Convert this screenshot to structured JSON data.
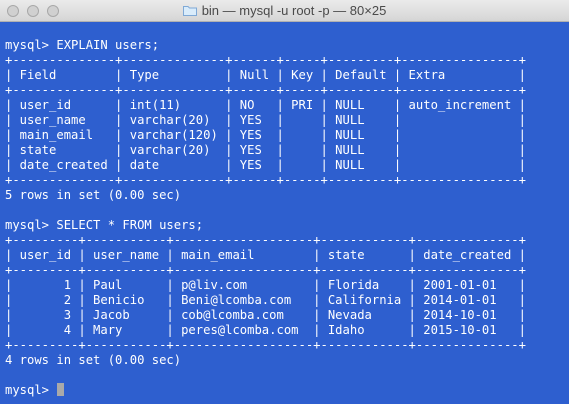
{
  "window": {
    "title": "bin — mysql -u root -p — 80×25"
  },
  "terminal": {
    "lines": [
      "mysql> EXPLAIN users;",
      "+--------------+--------------+------+-----+---------+----------------+",
      "| Field        | Type         | Null | Key | Default | Extra          |",
      "+--------------+--------------+------+-----+---------+----------------+",
      "| user_id      | int(11)      | NO   | PRI | NULL    | auto_increment |",
      "| user_name    | varchar(20)  | YES  |     | NULL    |                |",
      "| main_email   | varchar(120) | YES  |     | NULL    |                |",
      "| state        | varchar(20)  | YES  |     | NULL    |                |",
      "| date_created | date         | YES  |     | NULL    |                |",
      "+--------------+--------------+------+-----+---------+----------------+",
      "5 rows in set (0.00 sec)",
      "",
      "mysql> SELECT * FROM users;",
      "+---------+-----------+-------------------+------------+--------------+",
      "| user_id | user_name | main_email        | state      | date_created |",
      "+---------+-----------+-------------------+------------+--------------+",
      "|       1 | Paul      | p@liv.com         | Florida    | 2001-01-01   |",
      "|       2 | Benicio   | Beni@lcomba.com   | California | 2014-01-01   |",
      "|       3 | Jacob     | cob@lcomba.com    | Nevada     | 2014-10-01   |",
      "|       4 | Mary      | peres@lcomba.com  | Idaho      | 2015-10-01   |",
      "+---------+-----------+-------------------+------------+--------------+",
      "4 rows in set (0.00 sec)",
      ""
    ],
    "prompt": "mysql> "
  }
}
